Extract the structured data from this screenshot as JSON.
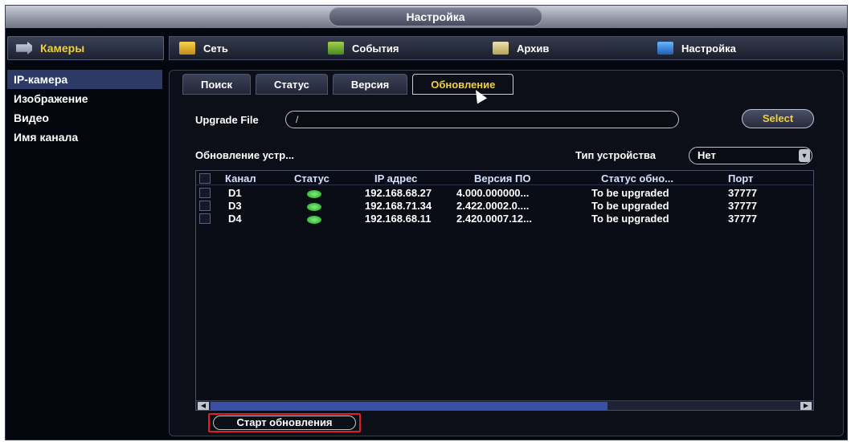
{
  "title": "Настройка",
  "camera_tab": {
    "label": "Камеры",
    "icon": "camera-icon"
  },
  "nav": [
    {
      "label": "Сеть",
      "icon": "network-icon"
    },
    {
      "label": "События",
      "icon": "events-icon"
    },
    {
      "label": "Архив",
      "icon": "archive-icon"
    },
    {
      "label": "Настройка",
      "icon": "settings-icon"
    }
  ],
  "sidebar": [
    {
      "label": "IP-камера",
      "active": true
    },
    {
      "label": "Изображение"
    },
    {
      "label": "Видео"
    },
    {
      "label": "Имя канала"
    }
  ],
  "tabs": [
    {
      "label": "Поиск"
    },
    {
      "label": "Статус"
    },
    {
      "label": "Версия"
    },
    {
      "label": "Обновление",
      "active": true
    }
  ],
  "upgrade": {
    "label": "Upgrade File",
    "value": "/",
    "select_label": "Select"
  },
  "device_list_label": "Обновление устр...",
  "device_type": {
    "label": "Тип устройства",
    "value": "Нет"
  },
  "table": {
    "headers": [
      "Канал",
      "Статус",
      "IP адрес",
      "Версия ПО",
      "Статус обно...",
      "Порт"
    ],
    "rows": [
      {
        "channel": "D1",
        "ip": "192.168.68.27",
        "version": "4.000.000000...",
        "upgrade_status": "To be upgraded",
        "port": "37777"
      },
      {
        "channel": "D3",
        "ip": "192.168.71.34",
        "version": "2.422.0002.0....",
        "upgrade_status": "To be upgraded",
        "port": "37777"
      },
      {
        "channel": "D4",
        "ip": "192.168.68.11",
        "version": "2.420.0007.12...",
        "upgrade_status": "To be upgraded",
        "port": "37777"
      }
    ]
  },
  "start_button": "Старт обновления",
  "colors": {
    "accent": "#f0d040",
    "highlight": "#e01f25",
    "status_online": "#3ad03a"
  }
}
